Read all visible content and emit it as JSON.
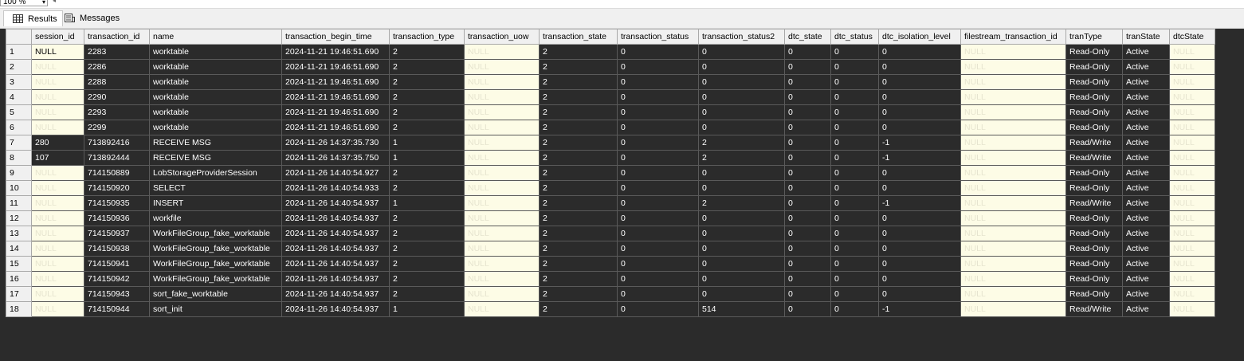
{
  "toolbar": {
    "zoom_value": "100 %"
  },
  "tabs": [
    {
      "label": "Results",
      "icon": "grid-icon"
    },
    {
      "label": "Messages",
      "icon": "messages-icon"
    }
  ],
  "grid": {
    "columns": [
      "session_id",
      "transaction_id",
      "name",
      "transaction_begin_time",
      "transaction_type",
      "transaction_uow",
      "transaction_state",
      "transaction_status",
      "transaction_status2",
      "dtc_state",
      "dtc_status",
      "dtc_isolation_level",
      "filestream_transaction_id",
      "tranType",
      "tranState",
      "dtcState"
    ],
    "rows": [
      [
        "1",
        "NULL",
        "2283",
        "worktable",
        "2024-11-21 19:46:51.690",
        "2",
        "NULL",
        "2",
        "0",
        "0",
        "0",
        "0",
        "0",
        "NULL",
        "Read-Only",
        "Active",
        "NULL"
      ],
      [
        "2",
        "NULL",
        "2286",
        "worktable",
        "2024-11-21 19:46:51.690",
        "2",
        "NULL",
        "2",
        "0",
        "0",
        "0",
        "0",
        "0",
        "NULL",
        "Read-Only",
        "Active",
        "NULL"
      ],
      [
        "3",
        "NULL",
        "2288",
        "worktable",
        "2024-11-21 19:46:51.690",
        "2",
        "NULL",
        "2",
        "0",
        "0",
        "0",
        "0",
        "0",
        "NULL",
        "Read-Only",
        "Active",
        "NULL"
      ],
      [
        "4",
        "NULL",
        "2290",
        "worktable",
        "2024-11-21 19:46:51.690",
        "2",
        "NULL",
        "2",
        "0",
        "0",
        "0",
        "0",
        "0",
        "NULL",
        "Read-Only",
        "Active",
        "NULL"
      ],
      [
        "5",
        "NULL",
        "2293",
        "worktable",
        "2024-11-21 19:46:51.690",
        "2",
        "NULL",
        "2",
        "0",
        "0",
        "0",
        "0",
        "0",
        "NULL",
        "Read-Only",
        "Active",
        "NULL"
      ],
      [
        "6",
        "NULL",
        "2299",
        "worktable",
        "2024-11-21 19:46:51.690",
        "2",
        "NULL",
        "2",
        "0",
        "0",
        "0",
        "0",
        "0",
        "NULL",
        "Read-Only",
        "Active",
        "NULL"
      ],
      [
        "7",
        "280",
        "713892416",
        "RECEIVE MSG",
        "2024-11-26 14:37:35.730",
        "1",
        "NULL",
        "2",
        "0",
        "2",
        "0",
        "0",
        "-1",
        "NULL",
        "Read/Write",
        "Active",
        "NULL"
      ],
      [
        "8",
        "107",
        "713892444",
        "RECEIVE MSG",
        "2024-11-26 14:37:35.750",
        "1",
        "NULL",
        "2",
        "0",
        "2",
        "0",
        "0",
        "-1",
        "NULL",
        "Read/Write",
        "Active",
        "NULL"
      ],
      [
        "9",
        "NULL",
        "714150889",
        "LobStorageProviderSession",
        "2024-11-26 14:40:54.927",
        "2",
        "NULL",
        "2",
        "0",
        "0",
        "0",
        "0",
        "0",
        "NULL",
        "Read-Only",
        "Active",
        "NULL"
      ],
      [
        "10",
        "NULL",
        "714150920",
        "SELECT",
        "2024-11-26 14:40:54.933",
        "2",
        "NULL",
        "2",
        "0",
        "0",
        "0",
        "0",
        "0",
        "NULL",
        "Read-Only",
        "Active",
        "NULL"
      ],
      [
        "11",
        "NULL",
        "714150935",
        "INSERT",
        "2024-11-26 14:40:54.937",
        "1",
        "NULL",
        "2",
        "0",
        "2",
        "0",
        "0",
        "-1",
        "NULL",
        "Read/Write",
        "Active",
        "NULL"
      ],
      [
        "12",
        "NULL",
        "714150936",
        "workfile",
        "2024-11-26 14:40:54.937",
        "2",
        "NULL",
        "2",
        "0",
        "0",
        "0",
        "0",
        "0",
        "NULL",
        "Read-Only",
        "Active",
        "NULL"
      ],
      [
        "13",
        "NULL",
        "714150937",
        "WorkFileGroup_fake_worktable",
        "2024-11-26 14:40:54.937",
        "2",
        "NULL",
        "2",
        "0",
        "0",
        "0",
        "0",
        "0",
        "NULL",
        "Read-Only",
        "Active",
        "NULL"
      ],
      [
        "14",
        "NULL",
        "714150938",
        "WorkFileGroup_fake_worktable",
        "2024-11-26 14:40:54.937",
        "2",
        "NULL",
        "2",
        "0",
        "0",
        "0",
        "0",
        "0",
        "NULL",
        "Read-Only",
        "Active",
        "NULL"
      ],
      [
        "15",
        "NULL",
        "714150941",
        "WorkFileGroup_fake_worktable",
        "2024-11-26 14:40:54.937",
        "2",
        "NULL",
        "2",
        "0",
        "0",
        "0",
        "0",
        "0",
        "NULL",
        "Read-Only",
        "Active",
        "NULL"
      ],
      [
        "16",
        "NULL",
        "714150942",
        "WorkFileGroup_fake_worktable",
        "2024-11-26 14:40:54.937",
        "2",
        "NULL",
        "2",
        "0",
        "0",
        "0",
        "0",
        "0",
        "NULL",
        "Read-Only",
        "Active",
        "NULL"
      ],
      [
        "17",
        "NULL",
        "714150943",
        "sort_fake_worktable",
        "2024-11-26 14:40:54.937",
        "2",
        "NULL",
        "2",
        "0",
        "0",
        "0",
        "0",
        "0",
        "NULL",
        "Read-Only",
        "Active",
        "NULL"
      ],
      [
        "18",
        "NULL",
        "714150944",
        "sort_init",
        "2024-11-26 14:40:54.937",
        "1",
        "NULL",
        "2",
        "0",
        "514",
        "0",
        "0",
        "-1",
        "NULL",
        "Read/Write",
        "Active",
        "NULL"
      ]
    ]
  }
}
